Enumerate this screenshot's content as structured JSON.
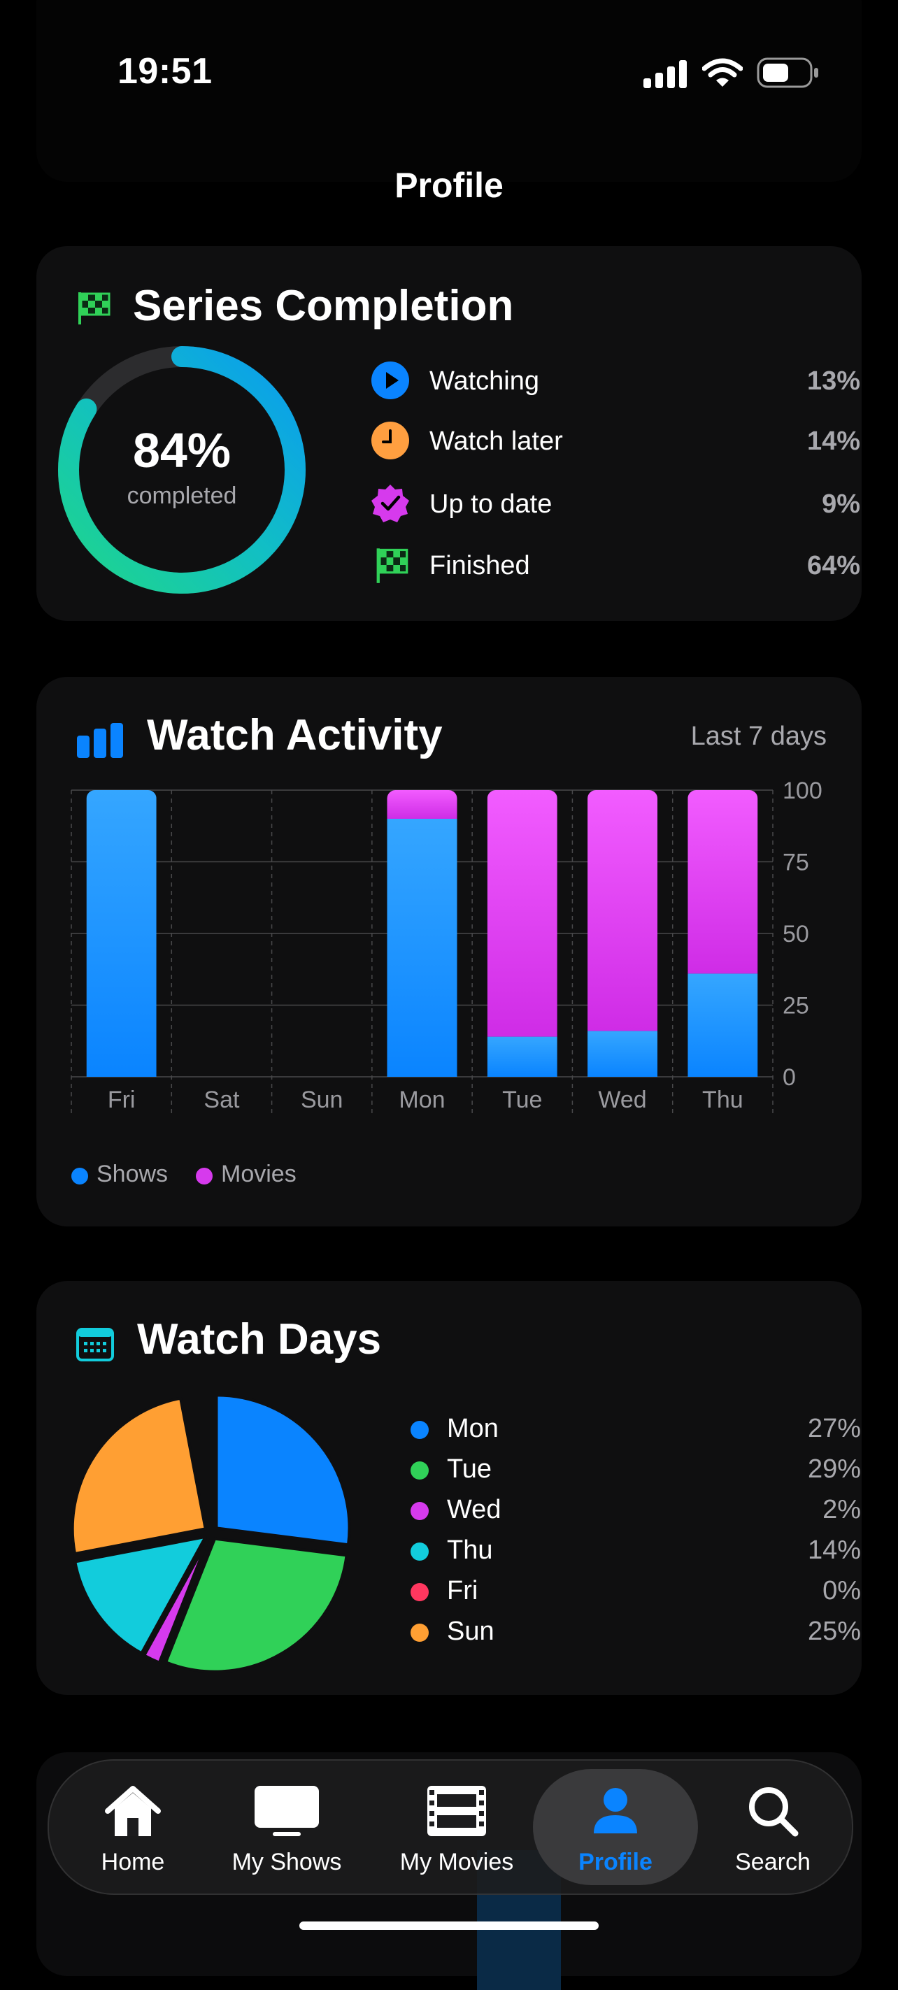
{
  "status_bar": {
    "time": "19:51"
  },
  "nav": {
    "title": "Profile"
  },
  "series_completion": {
    "title": "Series Completion",
    "completed_value": "84%",
    "completed_caption": "completed",
    "completed_fraction": 0.84,
    "items": [
      {
        "label": "Watching",
        "value": "13%",
        "icon": "play-circle-icon",
        "color": "#0a84ff"
      },
      {
        "label": "Watch later",
        "value": "14%",
        "icon": "clock-icon",
        "color": "#ff9f40"
      },
      {
        "label": "Up to date",
        "value": "9%",
        "icon": "checkmark-seal-icon",
        "color": "#d63aed"
      },
      {
        "label": "Finished",
        "value": "64%",
        "icon": "checkered-flag-icon",
        "color": "#30d158"
      }
    ]
  },
  "watch_activity": {
    "title": "Watch Activity",
    "range_label": "Last 7 days",
    "legend": [
      {
        "label": "Shows",
        "color": "#0a84ff"
      },
      {
        "label": "Movies",
        "color": "#d63aed"
      }
    ],
    "y_ticks": [
      "100",
      "75",
      "50",
      "25",
      "0"
    ]
  },
  "chart_data": {
    "type": "bar",
    "stacked": true,
    "categories": [
      "Fri",
      "Sat",
      "Sun",
      "Mon",
      "Tue",
      "Wed",
      "Thu"
    ],
    "series": [
      {
        "name": "Shows",
        "values": [
          100,
          0,
          0,
          90,
          14,
          16,
          36
        ]
      },
      {
        "name": "Movies",
        "values": [
          0,
          0,
          0,
          10,
          86,
          84,
          64
        ]
      }
    ],
    "ylim": [
      0,
      100
    ],
    "grid": true,
    "legend_position": "bottom-left"
  },
  "watch_days": {
    "title": "Watch Days",
    "items": [
      {
        "label": "Mon",
        "value": "27%",
        "fraction": 0.27,
        "color": "#0a84ff"
      },
      {
        "label": "Tue",
        "value": "29%",
        "fraction": 0.29,
        "color": "#30d158"
      },
      {
        "label": "Wed",
        "value": "2%",
        "fraction": 0.02,
        "color": "#d63aed"
      },
      {
        "label": "Thu",
        "value": "14%",
        "fraction": 0.14,
        "color": "#12ccdc"
      },
      {
        "label": "Fri",
        "value": "0%",
        "fraction": 0.0,
        "color": "#ff375f"
      },
      {
        "label": "Sun",
        "value": "25%",
        "fraction": 0.25,
        "color": "#ff9f33"
      }
    ]
  },
  "tab_bar": {
    "tabs": [
      {
        "label": "Home",
        "icon": "house-icon",
        "active": false
      },
      {
        "label": "My Shows",
        "icon": "tv-icon",
        "active": false
      },
      {
        "label": "My Movies",
        "icon": "film-icon",
        "active": false
      },
      {
        "label": "Profile",
        "icon": "person-icon",
        "active": true
      },
      {
        "label": "Search",
        "icon": "magnifying-glass-icon",
        "active": false
      }
    ]
  },
  "colors": {
    "accent": "#0a84ff",
    "background": "#000000",
    "card": "#0f0f10"
  }
}
